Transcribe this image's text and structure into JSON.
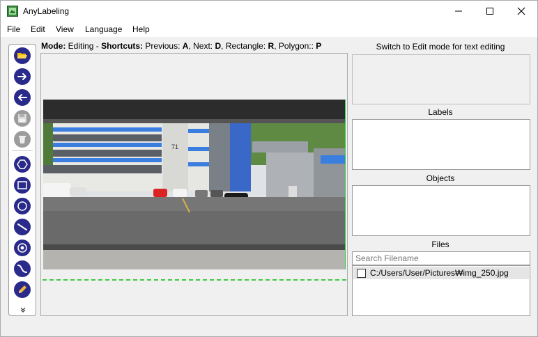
{
  "window": {
    "title": "AnyLabeling",
    "controls": {
      "minimize_icon": "minimize-icon",
      "maximize_icon": "maximize-icon",
      "close_icon": "close-icon"
    }
  },
  "menu": {
    "items": [
      "File",
      "Edit",
      "View",
      "Language",
      "Help"
    ]
  },
  "toolbar": {
    "tools": [
      {
        "name": "open-folder",
        "icon": "folder-open-icon",
        "enabled": true
      },
      {
        "name": "next-image",
        "icon": "arrow-right-icon",
        "enabled": true
      },
      {
        "name": "previous-image",
        "icon": "arrow-left-icon",
        "enabled": true
      },
      {
        "name": "save",
        "icon": "save-icon",
        "enabled": false
      },
      {
        "name": "delete",
        "icon": "trash-icon",
        "enabled": false
      },
      {
        "name": "create-polygon",
        "icon": "polygon-icon",
        "enabled": true
      },
      {
        "name": "create-rectangle",
        "icon": "rectangle-icon",
        "enabled": true
      },
      {
        "name": "create-circle",
        "icon": "circle-icon",
        "enabled": true
      },
      {
        "name": "create-line",
        "icon": "line-icon",
        "enabled": true
      },
      {
        "name": "create-point",
        "icon": "point-icon",
        "enabled": true
      },
      {
        "name": "create-linestrip",
        "icon": "linestrip-icon",
        "enabled": true
      },
      {
        "name": "edit",
        "icon": "pencil-icon",
        "enabled": true
      }
    ],
    "more_icon": "chevron-double-down-icon"
  },
  "mode_bar": {
    "mode_label": "Mode:",
    "mode_value": "Editing",
    "separator": "-",
    "shortcuts_label": "Shortcuts:",
    "s1": "Previous:",
    "k1": "A",
    "s2": ", Next:",
    "k2": "D",
    "s3": ", Rectangle:",
    "k3": "R",
    "s4": ", Polygon::",
    "k4": "P"
  },
  "canvas": {
    "building_number": "71"
  },
  "right_panel": {
    "description_hint": "Switch to Edit mode for text editing",
    "labels_title": "Labels",
    "objects_title": "Objects",
    "files_title": "Files",
    "search_placeholder": "Search Filename",
    "files": [
      {
        "path": "C:/Users/User/Pictures₩img_250.jpg",
        "checked": false
      }
    ]
  },
  "colors": {
    "tool_accent": "#2a2a8a",
    "tool_disabled": "#9c9c9c",
    "guide_line": "#3ec93e"
  }
}
